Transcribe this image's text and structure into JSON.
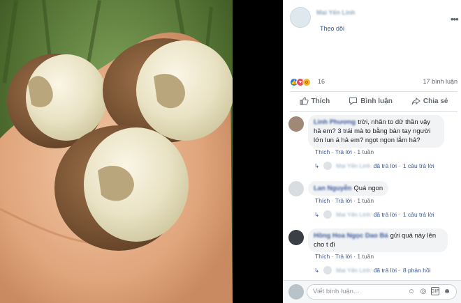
{
  "post": {
    "author": "Mai Yến Linh",
    "follow_label": "Theo dõi",
    "more_icon": "more-dots-icon",
    "reactions": [
      "like-icon",
      "love-icon",
      "wow-icon"
    ],
    "reaction_count": "16",
    "reply_count": "17 bình luận"
  },
  "actions": {
    "like": "Thích",
    "comment": "Bình luận",
    "share": "Chia sẻ"
  },
  "comments": [
    {
      "name": "Linh Phương",
      "text": "trời, nhãn to dữ thần vậy hả em? 3 trái mà to bằng bàn tay người lớn lun á hả em? ngọt ngon lắm hả?",
      "like": "Thích",
      "reply": "Trả lời",
      "time": "1 tuần",
      "reply_author": "Mai Yến Linh",
      "reply_text": "đã trả lời",
      "reply_count": "1 câu trả lời"
    },
    {
      "name": "Lan Nguyễn",
      "text": "Quá ngon",
      "like": "Thích",
      "reply": "Trả lời",
      "time": "1 tuần",
      "reply_author": "Mai Yến Linh",
      "reply_text": "đã trả lời",
      "reply_count": "1 câu trả lời"
    },
    {
      "name": "Hồng Hoa Ngọc Dao Bá",
      "text": "gửi quả này lên cho t đi",
      "like": "Thích",
      "reply": "Trả lời",
      "time": "1 tuần",
      "reply_author": "Mai Yến Linh",
      "reply_text": "đã trả lời",
      "reply_count": "8 phản hồi"
    }
  ],
  "composer": {
    "placeholder": "Viết bình luận...",
    "icons": [
      "emoji-icon",
      "camera-icon",
      "gif-icon",
      "sticker-icon"
    ]
  },
  "colors": {
    "link": "#385898",
    "muted": "#606770",
    "bubble": "#f2f3f5",
    "like_blue": "#1877f2"
  }
}
